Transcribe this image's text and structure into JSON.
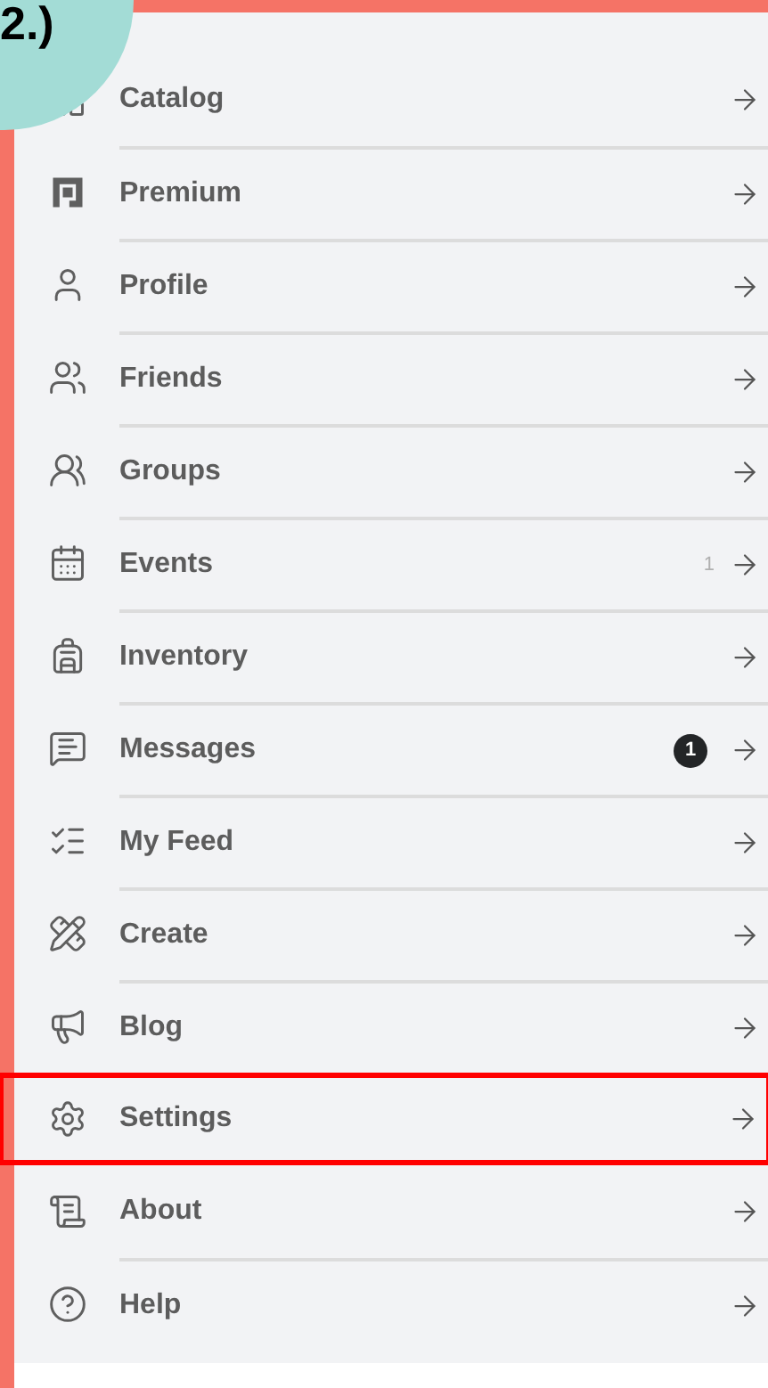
{
  "step_label": "2.)",
  "menu": {
    "items": [
      {
        "label": "Catalog",
        "highlighted": false
      },
      {
        "label": "Premium",
        "highlighted": false
      },
      {
        "label": "Profile",
        "highlighted": false
      },
      {
        "label": "Friends",
        "highlighted": false
      },
      {
        "label": "Groups",
        "highlighted": false
      },
      {
        "label": "Events",
        "highlighted": false,
        "count": "1"
      },
      {
        "label": "Inventory",
        "highlighted": false
      },
      {
        "label": "Messages",
        "highlighted": false,
        "badge": "1"
      },
      {
        "label": "My Feed",
        "highlighted": false
      },
      {
        "label": "Create",
        "highlighted": false
      },
      {
        "label": "Blog",
        "highlighted": false
      },
      {
        "label": "Settings",
        "highlighted": true
      },
      {
        "label": "About",
        "highlighted": false
      },
      {
        "label": "Help",
        "highlighted": false
      }
    ]
  }
}
